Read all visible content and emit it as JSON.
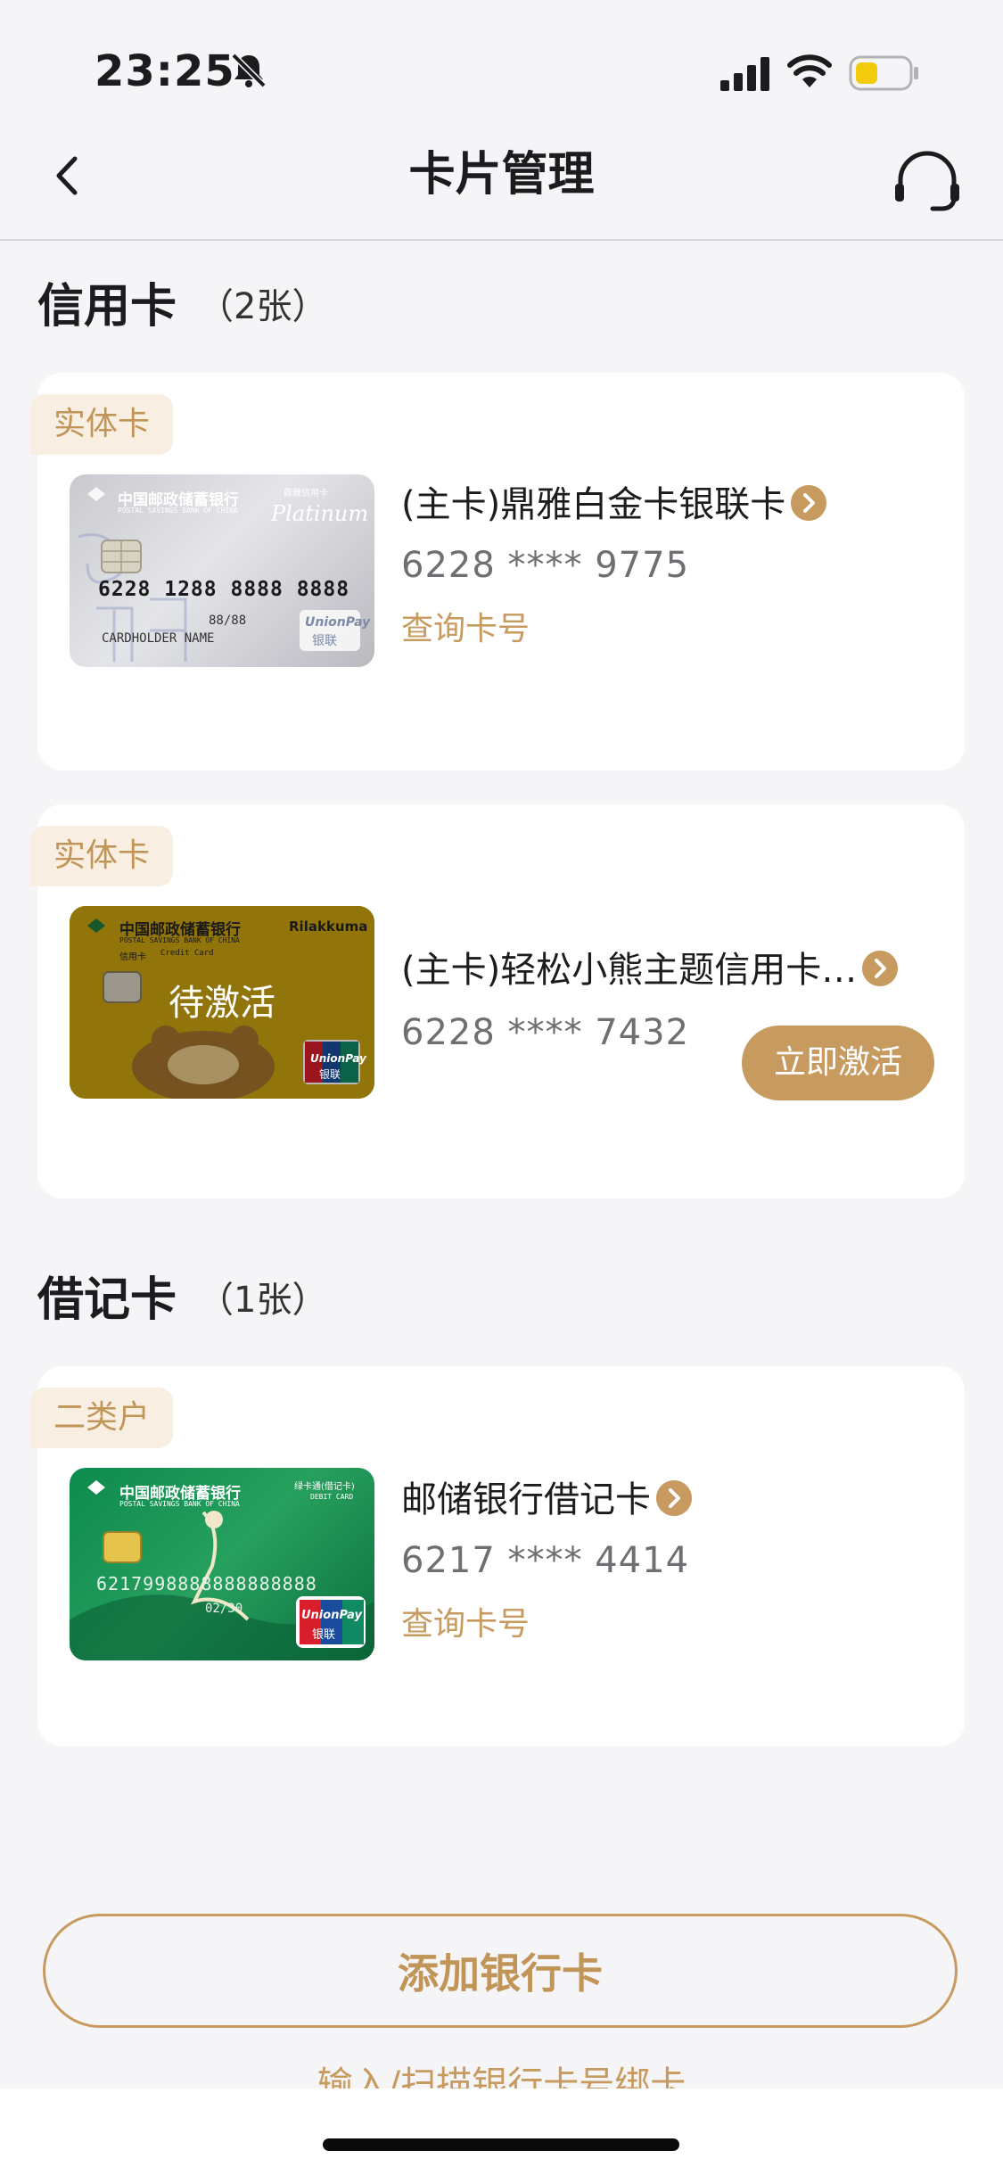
{
  "status_bar": {
    "time": "23:25",
    "icons": [
      "bell-slash-icon",
      "signal-icon",
      "wifi-icon",
      "battery-icon"
    ]
  },
  "nav": {
    "title": "卡片管理",
    "back_icon": "chevron-left-icon",
    "service_icon": "headset-icon"
  },
  "credit_section": {
    "title": "信用卡",
    "count": "（2张）",
    "cards": [
      {
        "tag": "实体卡",
        "name": "(主卡)鼎雅白金卡银联卡",
        "number": "6228 **** 9775",
        "action": "查询卡号",
        "thumb": {
          "bank": "中国邮政储蓄银行",
          "bank_en": "POSTAL SAVINGS BANK OF CHINA",
          "type_cn": "鼎雅信用卡",
          "type_en": "Platinum",
          "number": "6228 1288 8888 8888",
          "holder": "CARDHOLDER NAME",
          "expiry": "88/88",
          "brand": "UnionPay",
          "brand_cn": "银联"
        }
      },
      {
        "tag": "实体卡",
        "name": "(主卡)轻松小熊主题信用卡…",
        "number": "6228 **** 7432",
        "action": "立即激活",
        "thumb": {
          "bank": "中国邮政储蓄银行",
          "bank_en": "POSTAL SAVINGS BANK OF CHINA",
          "type_cn": "信用卡",
          "type_en": "Credit Card",
          "logo": "Rilakkuma",
          "overlay": "待激活",
          "brand": "UnionPay",
          "brand_cn": "银联"
        }
      }
    ]
  },
  "debit_section": {
    "title": "借记卡",
    "count": "（1张）",
    "cards": [
      {
        "tag": "二类户",
        "name": "邮储银行借记卡",
        "number": "6217 **** 4414",
        "action": "查询卡号",
        "thumb": {
          "bank": "中国邮政储蓄银行",
          "bank_en": "POSTAL SAVINGS BANK OF CHINA",
          "type_cn": "绿卡通(借记卡)",
          "type_en": "DEBIT CARD",
          "number": "6217998888888888888",
          "expiry": "02/30",
          "brand": "UnionPay",
          "brand_cn": "银联"
        }
      }
    ]
  },
  "add_button": "添加银行卡",
  "add_hint": "输入/扫描银行卡号绑卡",
  "colors": {
    "accent": "#c79a5f",
    "tag_bg": "#f8eee2",
    "background": "#f5f5f7"
  }
}
